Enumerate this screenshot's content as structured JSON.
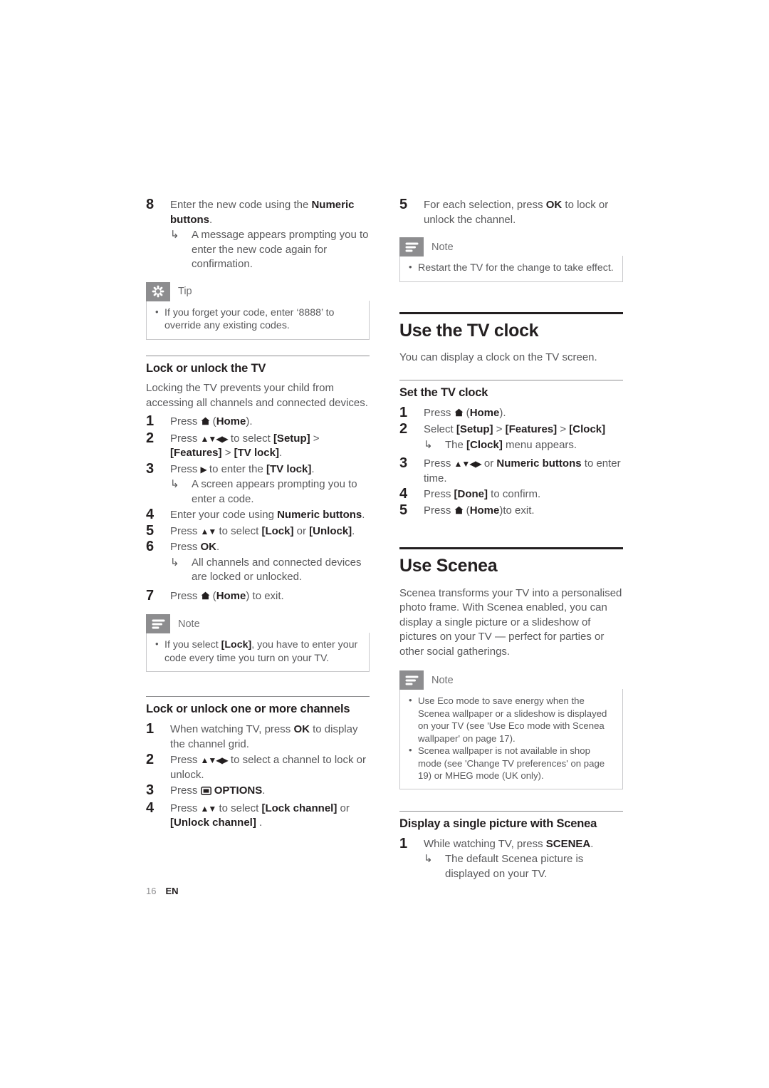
{
  "footer": {
    "page_number": "16",
    "language": "EN"
  },
  "icons": {
    "tip": "asterisk-icon",
    "note": "note-lines-icon",
    "home": "home-icon",
    "options": "options-icon",
    "sub_result": "hooked-arrow-icon",
    "nav_updown": "up-down-arrows-icon",
    "nav_all": "four-direction-arrows-icon",
    "right": "right-arrow-icon"
  },
  "colors": {
    "heading": "#231f20",
    "body_text": "#58585a",
    "callout_tab": "#8d8d8f",
    "callout_border": "#c9c9cb",
    "rule_h1": "#231f20",
    "rule_h2": "#8d8d8f"
  },
  "left_column": {
    "step8": {
      "number": "8",
      "text_1": "Enter the new code using the ",
      "bold_1": "Numeric buttons",
      "text_2": ".",
      "result": "A message appears prompting you to enter the new code again for confirmation."
    },
    "tip_callout": {
      "title": "Tip",
      "bullets": [
        "If you forget your code, enter ‘8888’ to override any existing codes."
      ]
    },
    "section_lock_tv": {
      "heading": "Lock or unlock the TV",
      "intro": "Locking the TV prevents your child from accessing all channels and connected devices.",
      "steps": [
        {
          "number": "1",
          "pre": "Press ",
          "icon": "home",
          "post_bold": "Home",
          "post": ")."
        },
        {
          "number": "2",
          "text_a": "Press ",
          "arrows": "▲▼◀▶",
          "text_b": " to select ",
          "bold_b": "[Setup]",
          "text_c": " > ",
          "bold_c": "[Features]",
          "text_d": " > ",
          "bold_d": "[TV lock]",
          "text_e": "."
        },
        {
          "number": "3",
          "text_a": "Press ",
          "arrow": "▶",
          "text_b": " to enter the ",
          "bold_b": "[TV lock]",
          "text_c": ".",
          "result": "A screen appears prompting you to enter a code."
        },
        {
          "number": "4",
          "text_a": "Enter your code using ",
          "bold_a": "Numeric buttons",
          "text_b": "."
        },
        {
          "number": "5",
          "text_a": "Press ",
          "arrows": "▲▼",
          "text_b": " to select ",
          "bold_b": "[Lock]",
          "text_c": " or ",
          "bold_c": "[Unlock]",
          "text_d": "."
        },
        {
          "number": "6",
          "text_a": "Press ",
          "bold_a": "OK",
          "text_b": ".",
          "result": "All channels and connected devices are locked or unlocked."
        },
        {
          "number": "7",
          "pre": "Press ",
          "icon": "home",
          "post_bold": "Home",
          "post": ") to exit."
        }
      ]
    },
    "note_callout": {
      "title": "Note",
      "bullet_pre": "If you select ",
      "bullet_bold": "[Lock]",
      "bullet_post": ", you have to enter your code every time you turn on your TV."
    },
    "section_lock_channels": {
      "heading": "Lock or unlock one or more channels",
      "steps": [
        {
          "number": "1",
          "text_a": "When watching TV, press ",
          "bold_a": "OK",
          "text_b": " to display the channel grid."
        },
        {
          "number": "2",
          "text_a": "Press ",
          "arrows": "▲▼◀▶",
          "text_b": " to select a channel to lock or unlock."
        },
        {
          "number": "3",
          "text_a": "Press ",
          "icon": "options",
          "bold_a": "OPTIONS",
          "text_b": "."
        },
        {
          "number": "4",
          "text_a": "Press ",
          "arrows": "▲▼",
          "text_b": " to select ",
          "bold_b": "[Lock channel]",
          "text_c": " or ",
          "bold_c": "[Unlock channel]",
          "text_d": " ."
        }
      ]
    }
  },
  "right_column": {
    "step5": {
      "number": "5",
      "text_a": "For each selection, press ",
      "bold_a": "OK",
      "text_b": " to lock or unlock the channel."
    },
    "note_callout_restart": {
      "title": "Note",
      "bullets": [
        "Restart the TV for the change to take effect."
      ]
    },
    "section_tv_clock": {
      "heading": "Use the TV clock",
      "intro": "You can display a clock on the TV screen."
    },
    "section_set_clock": {
      "heading": "Set the TV clock",
      "steps": [
        {
          "number": "1",
          "pre": "Press ",
          "icon": "home",
          "post_bold": "Home",
          "post": ")."
        },
        {
          "number": "2",
          "text_a": "Select ",
          "bold_a": "[Setup]",
          "text_b": " > ",
          "bold_b": "[Features]",
          "text_c": " > ",
          "bold_c": "[Clock]",
          "result_pre": "The ",
          "result_bold": "[Clock]",
          "result_post": " menu appears."
        },
        {
          "number": "3",
          "text_a": "Press ",
          "arrows": "▲▼◀▶",
          "text_b": " or ",
          "bold_b": "Numeric buttons",
          "text_c": " to enter time."
        },
        {
          "number": "4",
          "text_a": "Press ",
          "bold_a": "[Done]",
          "text_b": " to confirm."
        },
        {
          "number": "5",
          "pre": "Press ",
          "icon": "home",
          "post_bold": "Home",
          "post": ")to exit."
        }
      ]
    },
    "section_scenea": {
      "heading": "Use Scenea",
      "intro": "Scenea transforms your TV into a personalised photo frame. With Scenea enabled, you can display a single picture or a slideshow of pictures on your TV — perfect for parties or other social gatherings."
    },
    "note_callout_scenea": {
      "title": "Note",
      "bullets": [
        "Use Eco mode to save energy when the Scenea wallpaper or a slideshow is displayed on your TV (see 'Use Eco mode with Scenea wallpaper' on page 17).",
        "Scenea wallpaper is not available in shop mode (see 'Change TV preferences' on page 19) or MHEG mode (UK only)."
      ]
    },
    "section_single_picture": {
      "heading": "Display a single picture with Scenea",
      "steps": [
        {
          "number": "1",
          "text_a": "While watching TV, press ",
          "bold_a": "SCENEA",
          "text_b": ".",
          "result": "The default Scenea picture is displayed on your TV."
        }
      ]
    }
  }
}
